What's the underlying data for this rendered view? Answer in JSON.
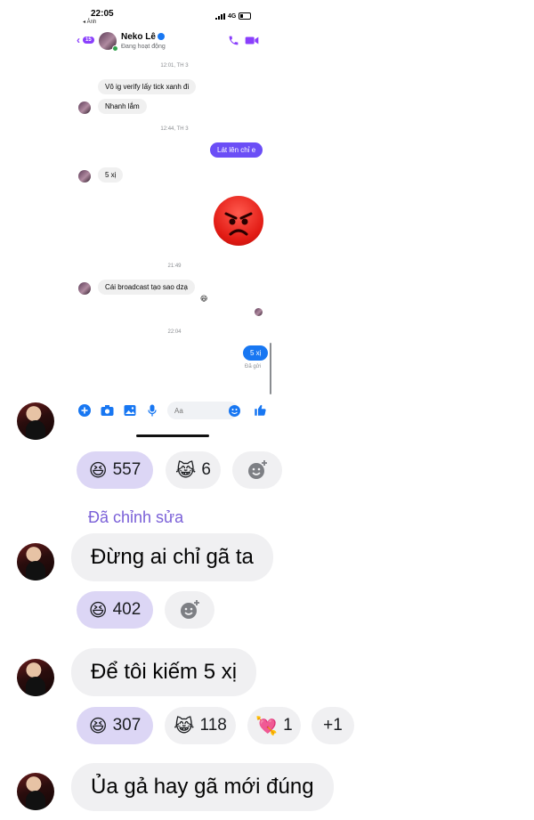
{
  "screenshot": {
    "status_bar": {
      "time": "22:05",
      "sub": "◂ Ảnh",
      "network": "4G"
    },
    "header": {
      "back_count": "15",
      "name": "Neko Lê",
      "status": "Đang hoạt động"
    },
    "messages": [
      {
        "type": "timestamp",
        "text": "12:01, TH 3"
      },
      {
        "type": "in",
        "text": "Vô ig verify lấy tick xanh đi"
      },
      {
        "type": "in",
        "text": "Nhanh lắm"
      },
      {
        "type": "timestamp",
        "text": "12:44, TH 3"
      },
      {
        "type": "out",
        "text": "Lát lên chỉ e"
      },
      {
        "type": "in",
        "text": "5 xị"
      },
      {
        "type": "timestamp",
        "text": "21:49"
      },
      {
        "type": "in",
        "text": "Cái broadcast tạo sao dzạ"
      },
      {
        "type": "timestamp",
        "text": "22:04"
      },
      {
        "type": "out",
        "text": "5 xị"
      }
    ],
    "sent_label": "Đã gửi",
    "composer": {
      "placeholder": "Aa"
    }
  },
  "post_reactions": [
    {
      "emoji": "😆",
      "count": "557",
      "mine": true
    },
    {
      "emoji": "😹",
      "count": "6",
      "mine": false
    }
  ],
  "comments": [
    {
      "edited_label": "Đã chỉnh sửa",
      "text": "Đừng ai chỉ gã ta",
      "reactions": [
        {
          "emoji": "😆",
          "count": "402",
          "mine": true
        }
      ]
    },
    {
      "text": "Để tôi kiếm 5 xị",
      "reactions": [
        {
          "emoji": "😆",
          "count": "307",
          "mine": true
        },
        {
          "emoji": "😹",
          "count": "118",
          "mine": false
        },
        {
          "emoji": "💘",
          "count": "1",
          "mine": false
        }
      ],
      "more": "+1"
    },
    {
      "text": "Ủa gả hay gã mới đúng"
    }
  ],
  "colors": {
    "messenger_purple": "#8a3ffc",
    "outgoing_bubble": "#6b4ef6",
    "blue_bubble": "#1877f2",
    "edited_label": "#7b61d8",
    "my_reaction_bg": "#dcd6f5"
  }
}
